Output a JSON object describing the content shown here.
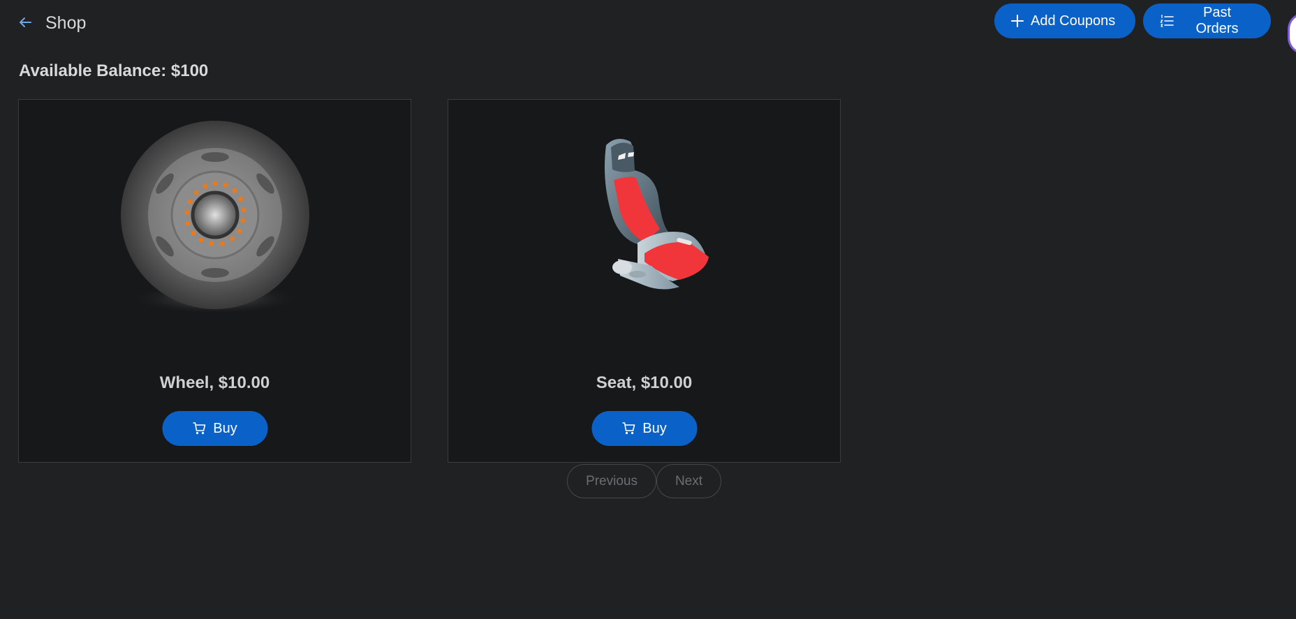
{
  "header": {
    "title": "Shop",
    "add_coupons_label": "Add Coupons",
    "past_orders_label": "Past Orders"
  },
  "balance": {
    "label": "Available Balance: $100"
  },
  "products": [
    {
      "title": "Wheel, $10.00",
      "buy_label": "Buy",
      "icon": "wheel-image"
    },
    {
      "title": "Seat, $10.00",
      "buy_label": "Buy",
      "icon": "seat-image"
    }
  ],
  "pagination": {
    "previous_label": "Previous",
    "next_label": "Next"
  },
  "colors": {
    "background": "#1f2123",
    "card": "#17181a",
    "accent": "#0a62c9"
  }
}
